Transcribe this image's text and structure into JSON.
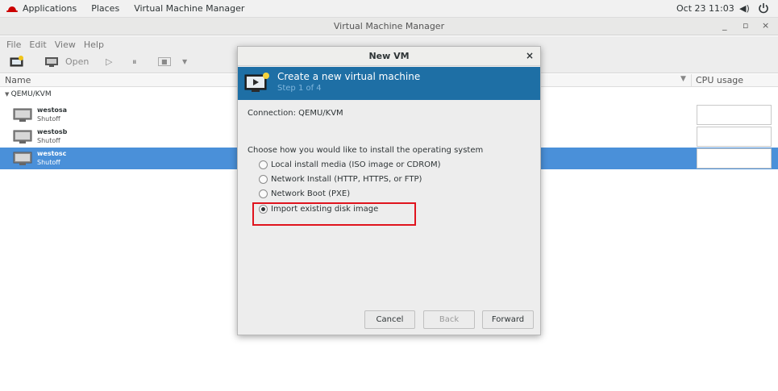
{
  "topbar": {
    "applications": "Applications",
    "places": "Places",
    "app_name": "Virtual Machine Manager",
    "clock": "Oct 23  11:03",
    "volume_icon": "speaker-icon",
    "power_icon": "power-icon",
    "brand_color": "#cc0000"
  },
  "window": {
    "title": "Virtual Machine Manager",
    "minimize": "_",
    "maximize": "▫",
    "close": "×"
  },
  "menu": [
    "File",
    "Edit",
    "View",
    "Help"
  ],
  "toolbar": {
    "open_label": "Open",
    "icons": [
      "new-vm-icon",
      "monitor-icon",
      "play-icon",
      "pause-icon",
      "stop-icon",
      "dropdown-icon"
    ]
  },
  "columns": {
    "name": "Name",
    "cpu": "CPU usage"
  },
  "connection_group": "QEMU/KVM",
  "vms": [
    {
      "name": "westosa",
      "state": "Shutoff",
      "selected": false
    },
    {
      "name": "westosb",
      "state": "Shutoff",
      "selected": false
    },
    {
      "name": "westosc",
      "state": "Shutoff",
      "selected": true
    }
  ],
  "dialog": {
    "title": "New VM",
    "close": "×",
    "header": "Create a new virtual machine",
    "step": "Step 1 of 4",
    "connection": "Connection:  QEMU/KVM",
    "prompt": "Choose how you would like to install the operating system",
    "options": [
      {
        "label": "Local install media (ISO image or CDROM)",
        "checked": false
      },
      {
        "label": "Network Install (HTTP, HTTPS, or FTP)",
        "checked": false
      },
      {
        "label": "Network Boot (PXE)",
        "checked": false
      },
      {
        "label": "Import existing disk image",
        "checked": true
      }
    ],
    "buttons": {
      "cancel": "Cancel",
      "back": "Back",
      "forward": "Forward"
    },
    "banner_color": "#1e6fa5",
    "highlight_color": "#e0141e"
  }
}
